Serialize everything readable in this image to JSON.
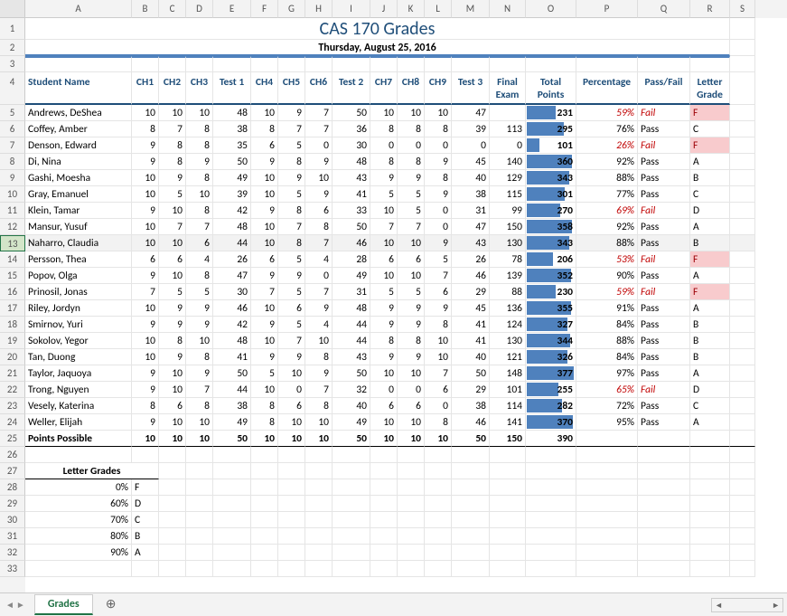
{
  "title": "CAS 170 Grades",
  "subtitle": "Thursday, August 25, 2016",
  "cols": [
    "A",
    "B",
    "C",
    "D",
    "E",
    "F",
    "G",
    "H",
    "I",
    "J",
    "K",
    "L",
    "M",
    "N",
    "O",
    "P",
    "Q",
    "R",
    "S"
  ],
  "widths": [
    118,
    30,
    30,
    30,
    42,
    30,
    30,
    30,
    42,
    30,
    30,
    30,
    42,
    40,
    56,
    68,
    58,
    44,
    28
  ],
  "headers": [
    "Student Name",
    "CH1",
    "CH2",
    "CH3",
    "Test 1",
    "CH4",
    "CH5",
    "CH6",
    "Test 2",
    "CH7",
    "CH8",
    "CH9",
    "Test 3",
    "Final Exam",
    "Total Points",
    "Percentage",
    "Pass/Fail",
    "Letter Grade"
  ],
  "rows": [
    {
      "name": "Andrews, DeShea",
      "v": [
        10,
        10,
        10,
        48,
        10,
        9,
        7,
        50,
        10,
        10,
        10,
        47,
        "",
        231
      ],
      "pct": "59%",
      "pf": "Fail",
      "lg": "F",
      "fail": true
    },
    {
      "name": "Coffey, Amber",
      "v": [
        8,
        7,
        8,
        38,
        8,
        7,
        7,
        36,
        8,
        8,
        8,
        39,
        113,
        295
      ],
      "pct": "76%",
      "pf": "Pass",
      "lg": "C",
      "fail": false
    },
    {
      "name": "Denson, Edward",
      "v": [
        9,
        8,
        8,
        35,
        6,
        5,
        0,
        30,
        0,
        0,
        0,
        0,
        0,
        101
      ],
      "pct": "26%",
      "pf": "Fail",
      "lg": "F",
      "fail": true
    },
    {
      "name": "Di, Nina",
      "v": [
        9,
        8,
        9,
        50,
        9,
        8,
        9,
        48,
        8,
        8,
        9,
        45,
        140,
        360
      ],
      "pct": "92%",
      "pf": "Pass",
      "lg": "A",
      "fail": false
    },
    {
      "name": "Gashi, Moesha",
      "v": [
        10,
        9,
        8,
        49,
        10,
        9,
        10,
        43,
        9,
        9,
        8,
        40,
        129,
        343
      ],
      "pct": "88%",
      "pf": "Pass",
      "lg": "B",
      "fail": false
    },
    {
      "name": "Gray, Emanuel",
      "v": [
        10,
        5,
        10,
        39,
        10,
        5,
        9,
        41,
        5,
        5,
        9,
        38,
        115,
        301
      ],
      "pct": "77%",
      "pf": "Pass",
      "lg": "C",
      "fail": false
    },
    {
      "name": "Klein, Tamar",
      "v": [
        9,
        10,
        8,
        42,
        9,
        8,
        6,
        33,
        10,
        5,
        0,
        31,
        99,
        270
      ],
      "pct": "69%",
      "pf": "Fail",
      "lg": "D",
      "fail": true
    },
    {
      "name": "Mansur, Yusuf",
      "v": [
        10,
        7,
        7,
        48,
        10,
        7,
        8,
        50,
        7,
        7,
        0,
        47,
        150,
        358
      ],
      "pct": "92%",
      "pf": "Pass",
      "lg": "A",
      "fail": false
    },
    {
      "name": "Naharro, Claudia",
      "v": [
        10,
        10,
        6,
        44,
        10,
        8,
        7,
        46,
        10,
        10,
        9,
        43,
        130,
        343
      ],
      "pct": "88%",
      "pf": "Pass",
      "lg": "B",
      "fail": false,
      "sel": true
    },
    {
      "name": "Persson, Thea",
      "v": [
        6,
        6,
        4,
        26,
        6,
        5,
        4,
        28,
        6,
        6,
        5,
        26,
        78,
        206
      ],
      "pct": "53%",
      "pf": "Fail",
      "lg": "F",
      "fail": true
    },
    {
      "name": "Popov, Olga",
      "v": [
        9,
        10,
        8,
        47,
        9,
        9,
        0,
        49,
        10,
        10,
        7,
        46,
        139,
        352
      ],
      "pct": "90%",
      "pf": "Pass",
      "lg": "A",
      "fail": false
    },
    {
      "name": "Prinosil, Jonas",
      "v": [
        7,
        5,
        5,
        30,
        7,
        5,
        7,
        31,
        5,
        5,
        6,
        29,
        88,
        230
      ],
      "pct": "59%",
      "pf": "Fail",
      "lg": "F",
      "fail": true
    },
    {
      "name": "Riley, Jordyn",
      "v": [
        10,
        9,
        9,
        46,
        10,
        6,
        9,
        48,
        9,
        9,
        9,
        45,
        136,
        355
      ],
      "pct": "91%",
      "pf": "Pass",
      "lg": "A",
      "fail": false
    },
    {
      "name": "Smirnov, Yuri",
      "v": [
        9,
        9,
        9,
        42,
        9,
        5,
        4,
        44,
        9,
        9,
        8,
        41,
        124,
        327
      ],
      "pct": "84%",
      "pf": "Pass",
      "lg": "B",
      "fail": false
    },
    {
      "name": "Sokolov, Yegor",
      "v": [
        10,
        8,
        10,
        48,
        10,
        7,
        10,
        44,
        8,
        8,
        10,
        41,
        130,
        344
      ],
      "pct": "88%",
      "pf": "Pass",
      "lg": "B",
      "fail": false
    },
    {
      "name": "Tan, Duong",
      "v": [
        10,
        9,
        8,
        41,
        9,
        9,
        8,
        43,
        9,
        9,
        10,
        40,
        121,
        326
      ],
      "pct": "84%",
      "pf": "Pass",
      "lg": "B",
      "fail": false
    },
    {
      "name": "Taylor, Jaquoya",
      "v": [
        9,
        10,
        9,
        50,
        5,
        10,
        9,
        50,
        10,
        10,
        7,
        50,
        148,
        377
      ],
      "pct": "97%",
      "pf": "Pass",
      "lg": "A",
      "fail": false
    },
    {
      "name": "Trong, Nguyen",
      "v": [
        9,
        10,
        7,
        44,
        10,
        0,
        7,
        32,
        0,
        0,
        6,
        29,
        101,
        255
      ],
      "pct": "65%",
      "pf": "Fail",
      "lg": "D",
      "fail": true
    },
    {
      "name": "Vesely, Katerina",
      "v": [
        8,
        6,
        8,
        38,
        8,
        6,
        8,
        40,
        6,
        6,
        0,
        38,
        114,
        282
      ],
      "pct": "72%",
      "pf": "Pass",
      "lg": "C",
      "fail": false
    },
    {
      "name": "Weller, Elijah",
      "v": [
        9,
        10,
        10,
        49,
        8,
        10,
        10,
        49,
        10,
        10,
        8,
        46,
        141,
        370
      ],
      "pct": "95%",
      "pf": "Pass",
      "lg": "A",
      "fail": false
    }
  ],
  "possible": {
    "name": "Points Possible",
    "v": [
      10,
      10,
      10,
      50,
      10,
      10,
      10,
      50,
      10,
      10,
      10,
      50,
      150,
      390
    ]
  },
  "letterGradesHeader": "Letter Grades",
  "letterGrades": [
    {
      "pct": "0%",
      "g": "F"
    },
    {
      "pct": "60%",
      "g": "D"
    },
    {
      "pct": "70%",
      "g": "C"
    },
    {
      "pct": "80%",
      "g": "B"
    },
    {
      "pct": "90%",
      "g": "A"
    }
  ],
  "maxPoints": 390,
  "tabName": "Grades",
  "chart_data": {
    "type": "table",
    "title": "CAS 170 Grades",
    "columns": [
      "Student Name",
      "CH1",
      "CH2",
      "CH3",
      "Test 1",
      "CH4",
      "CH5",
      "CH6",
      "Test 2",
      "CH7",
      "CH8",
      "CH9",
      "Test 3",
      "Final Exam",
      "Total Points",
      "Percentage",
      "Pass/Fail",
      "Letter Grade"
    ]
  }
}
